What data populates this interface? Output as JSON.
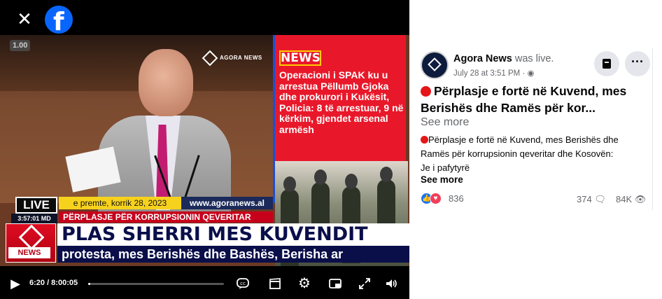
{
  "player": {
    "close_icon": "close-icon",
    "fb_logo_letter": "f",
    "speed_badge": "1.00",
    "watermark": "AGORA NEWS",
    "news_panel": {
      "tag": "NEWS",
      "text": "Operacioni i SPAK ku u arrestua Pëllumb Gjoka dhe prokurori i Kukësit, Policia: 8 të arrestuar, 9 në kërkim, gjendet arsenal armësh"
    },
    "lower_third": {
      "live": "LIVE",
      "date": "e premte, korrik 28, 2023",
      "site": "www.agoranews.al",
      "clock": "3:57:01 MD",
      "topic": "PËRPLASJE PËR KORRUPSIONIN QEVERITAR",
      "logo_label": "NEWS",
      "headline": "PLAS SHERRI MES KUVENDIT",
      "ticker": "protesta, mes Berishës dhe Bashës, Berisha ar"
    },
    "controls": {
      "time": "6:20 / 8:00:05",
      "progress": 0.013
    }
  },
  "post": {
    "author": "Agora News",
    "was_live": "was live.",
    "date": "July 28 at 3:51 PM · ",
    "globe_icon": "globe-icon",
    "title": "Përplasje e fortë në Kuvend, mes Berishës dhe Ramës për kor...",
    "see_more_title": "See more",
    "body_line1": "Përplasje e fortë në Kuvend, mes Berishës dhe",
    "body_line2": "Ramës për korrupsionin qeveritar dhe Kosovën:",
    "body_line3": "Je i pafytyrë",
    "see_more_body": "See more",
    "reactions_count": "836",
    "comments_count": "374",
    "views_count": "84K"
  },
  "colors": {
    "facebook_blue": "#0866ff",
    "news_red": "#e8182a",
    "live_dot_red": "#e4161a",
    "headline_navy": "#0a0f4a"
  }
}
